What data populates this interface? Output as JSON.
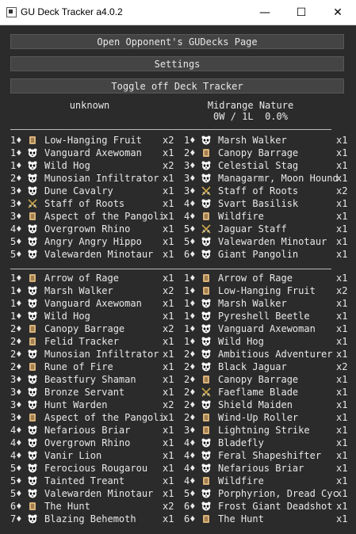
{
  "window": {
    "title": "GU Deck Tracker a4.0.2",
    "minimize_glyph": "—",
    "maximize_glyph": "☐",
    "close_glyph": "✕"
  },
  "buttons": {
    "open_page": "Open Opponent's GUDecks Page",
    "settings": "Settings",
    "toggle_tracker": "Toggle off Deck Tracker"
  },
  "opponent": {
    "name": "unknown"
  },
  "deck": {
    "name": "Midrange Nature",
    "record": "0W / 1L",
    "winrate": "0.0%"
  },
  "section1": {
    "left": [
      {
        "cost": "1♦",
        "type": "scroll",
        "name": "Low-Hanging Fruit",
        "count": "x2"
      },
      {
        "cost": "1♦",
        "type": "panda",
        "name": "Vanguard Axewoman",
        "count": "x1"
      },
      {
        "cost": "1♦",
        "type": "panda",
        "name": "Wild Hog",
        "count": "x2"
      },
      {
        "cost": "2♦",
        "type": "panda",
        "name": "Munosian Infiltrator",
        "count": "x1"
      },
      {
        "cost": "3♦",
        "type": "panda",
        "name": "Dune Cavalry",
        "count": "x1"
      },
      {
        "cost": "3♦",
        "type": "swords",
        "name": "Staff of Roots",
        "count": "x1"
      },
      {
        "cost": "3♦",
        "type": "scroll",
        "name": "Aspect of the Pangolin",
        "count": "x1"
      },
      {
        "cost": "4♦",
        "type": "panda",
        "name": "Overgrown Rhino",
        "count": "x1"
      },
      {
        "cost": "5♦",
        "type": "panda",
        "name": "Angry Angry Hippo",
        "count": "x1"
      },
      {
        "cost": "5♦",
        "type": "panda",
        "name": "Valewarden Minotaur",
        "count": "x1"
      }
    ],
    "right": [
      {
        "cost": "1♦",
        "type": "panda",
        "name": "Marsh Walker",
        "count": "x1"
      },
      {
        "cost": "2♦",
        "type": "scroll",
        "name": "Canopy Barrage",
        "count": "x1"
      },
      {
        "cost": "3♦",
        "type": "panda",
        "name": "Celestial Stag",
        "count": "x1"
      },
      {
        "cost": "3♦",
        "type": "panda",
        "name": "Managarmr, Moon Hound",
        "count": "x1"
      },
      {
        "cost": "3♦",
        "type": "swords",
        "name": "Staff of Roots",
        "count": "x2"
      },
      {
        "cost": "4♦",
        "type": "panda",
        "name": "Svart Basilisk",
        "count": "x1"
      },
      {
        "cost": "4♦",
        "type": "scroll",
        "name": "Wildfire",
        "count": "x1"
      },
      {
        "cost": "5♦",
        "type": "swords",
        "name": "Jaguar Staff",
        "count": "x1"
      },
      {
        "cost": "5♦",
        "type": "panda",
        "name": "Valewarden Minotaur",
        "count": "x1"
      },
      {
        "cost": "6♦",
        "type": "panda",
        "name": "Giant Pangolin",
        "count": "x1"
      }
    ]
  },
  "section2": {
    "left": [
      {
        "cost": "1♦",
        "type": "scroll",
        "name": "Arrow of Rage",
        "count": "x1"
      },
      {
        "cost": "1♦",
        "type": "panda",
        "name": "Marsh Walker",
        "count": "x2"
      },
      {
        "cost": "1♦",
        "type": "panda",
        "name": "Vanguard Axewoman",
        "count": "x1"
      },
      {
        "cost": "1♦",
        "type": "panda",
        "name": "Wild Hog",
        "count": "x1"
      },
      {
        "cost": "2♦",
        "type": "scroll",
        "name": "Canopy Barrage",
        "count": "x2"
      },
      {
        "cost": "2♦",
        "type": "scroll",
        "name": "Felid Tracker",
        "count": "x1"
      },
      {
        "cost": "2♦",
        "type": "panda",
        "name": "Munosian Infiltrator",
        "count": "x1"
      },
      {
        "cost": "2♦",
        "type": "scroll",
        "name": "Rune of Fire",
        "count": "x1"
      },
      {
        "cost": "3♦",
        "type": "panda",
        "name": "Beastfury Shaman",
        "count": "x1"
      },
      {
        "cost": "3♦",
        "type": "panda",
        "name": "Bronze Servant",
        "count": "x1"
      },
      {
        "cost": "3♦",
        "type": "panda",
        "name": "Hunt Warden",
        "count": "x2"
      },
      {
        "cost": "3♦",
        "type": "scroll",
        "name": "Aspect of the Pangolin",
        "count": "x1"
      },
      {
        "cost": "4♦",
        "type": "panda",
        "name": "Nefarious Briar",
        "count": "x1"
      },
      {
        "cost": "4♦",
        "type": "panda",
        "name": "Overgrown Rhino",
        "count": "x1"
      },
      {
        "cost": "4♦",
        "type": "panda",
        "name": "Vanir Lion",
        "count": "x1"
      },
      {
        "cost": "5♦",
        "type": "panda",
        "name": "Ferocious Rougarou",
        "count": "x1"
      },
      {
        "cost": "5♦",
        "type": "panda",
        "name": "Tainted Treant",
        "count": "x1"
      },
      {
        "cost": "5♦",
        "type": "panda",
        "name": "Valewarden Minotaur",
        "count": "x1"
      },
      {
        "cost": "6♦",
        "type": "scroll",
        "name": "The Hunt",
        "count": "x2"
      },
      {
        "cost": "7♦",
        "type": "panda",
        "name": "Blazing Behemoth",
        "count": "x1"
      }
    ],
    "right": [
      {
        "cost": "1♦",
        "type": "scroll",
        "name": "Arrow of Rage",
        "count": "x1"
      },
      {
        "cost": "1♦",
        "type": "scroll",
        "name": "Low-Hanging Fruit",
        "count": "x2"
      },
      {
        "cost": "1♦",
        "type": "panda",
        "name": "Marsh Walker",
        "count": "x1"
      },
      {
        "cost": "1♦",
        "type": "panda",
        "name": "Pyreshell Beetle",
        "count": "x1"
      },
      {
        "cost": "1♦",
        "type": "panda",
        "name": "Vanguard Axewoman",
        "count": "x1"
      },
      {
        "cost": "1♦",
        "type": "panda",
        "name": "Wild Hog",
        "count": "x1"
      },
      {
        "cost": "2♦",
        "type": "panda",
        "name": "Ambitious Adventurer",
        "count": "x1"
      },
      {
        "cost": "2♦",
        "type": "panda",
        "name": "Black Jaguar",
        "count": "x2"
      },
      {
        "cost": "2♦",
        "type": "scroll",
        "name": "Canopy Barrage",
        "count": "x1"
      },
      {
        "cost": "2♦",
        "type": "swords",
        "name": "Faeflame Blade",
        "count": "x1"
      },
      {
        "cost": "2♦",
        "type": "panda",
        "name": "Shield Maiden",
        "count": "x1"
      },
      {
        "cost": "2♦",
        "type": "scroll",
        "name": "Wind-Up Roller",
        "count": "x1"
      },
      {
        "cost": "3♦",
        "type": "scroll",
        "name": "Lightning Strike",
        "count": "x1"
      },
      {
        "cost": "4♦",
        "type": "panda",
        "name": "Bladefly",
        "count": "x1"
      },
      {
        "cost": "4♦",
        "type": "panda",
        "name": "Feral Shapeshifter",
        "count": "x1"
      },
      {
        "cost": "4♦",
        "type": "panda",
        "name": "Nefarious Briar",
        "count": "x1"
      },
      {
        "cost": "4♦",
        "type": "scroll",
        "name": "Wildfire",
        "count": "x1"
      },
      {
        "cost": "5♦",
        "type": "panda",
        "name": "Porphyrion, Dread Cyclops",
        "count": "x1"
      },
      {
        "cost": "6♦",
        "type": "panda",
        "name": "Frost Giant Deadshot",
        "count": "x1"
      },
      {
        "cost": "6♦",
        "type": "scroll",
        "name": "The Hunt",
        "count": "x1"
      }
    ]
  },
  "icons": {
    "scroll": "scroll-icon",
    "panda": "panda-icon",
    "swords": "crossed-swords-icon"
  },
  "colors": {
    "background": "#2b2b2b",
    "button": "#444444",
    "text": "#e8e8e8",
    "scroll": "#d8b27a",
    "swords": "#c9a64a"
  }
}
